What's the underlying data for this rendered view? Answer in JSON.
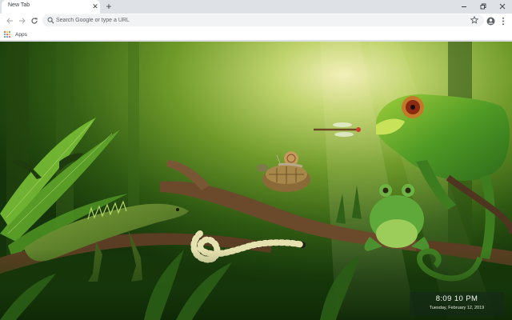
{
  "browser": {
    "tab": {
      "title": "New Tab"
    },
    "omnibox": {
      "placeholder": "Search Google or type a URL"
    },
    "bookmarks": [
      {
        "label": "Apps",
        "icon": "apps-grid-icon"
      }
    ]
  },
  "widget": {
    "time": "8:09 10 PM",
    "date": "Tuesday, February 12, 2019"
  },
  "colors": {
    "tabstrip": "#dee1e6",
    "toolbar": "#ffffff",
    "omnibox": "#f1f3f4",
    "icon": "#5f6368",
    "apps_dots": [
      "#ea4335",
      "#fbbc04",
      "#34a853",
      "#4285f4",
      "#ea4335",
      "#fbbc04",
      "#34a853",
      "#4285f4",
      "#ea4335"
    ]
  },
  "background": {
    "subject": "jungle scene with chameleon, iguana, frog, turtle, snail, snake and dragonfly",
    "palette": [
      "#b7cd6f",
      "#6f9a2a",
      "#2f5a12",
      "#14330a"
    ]
  }
}
